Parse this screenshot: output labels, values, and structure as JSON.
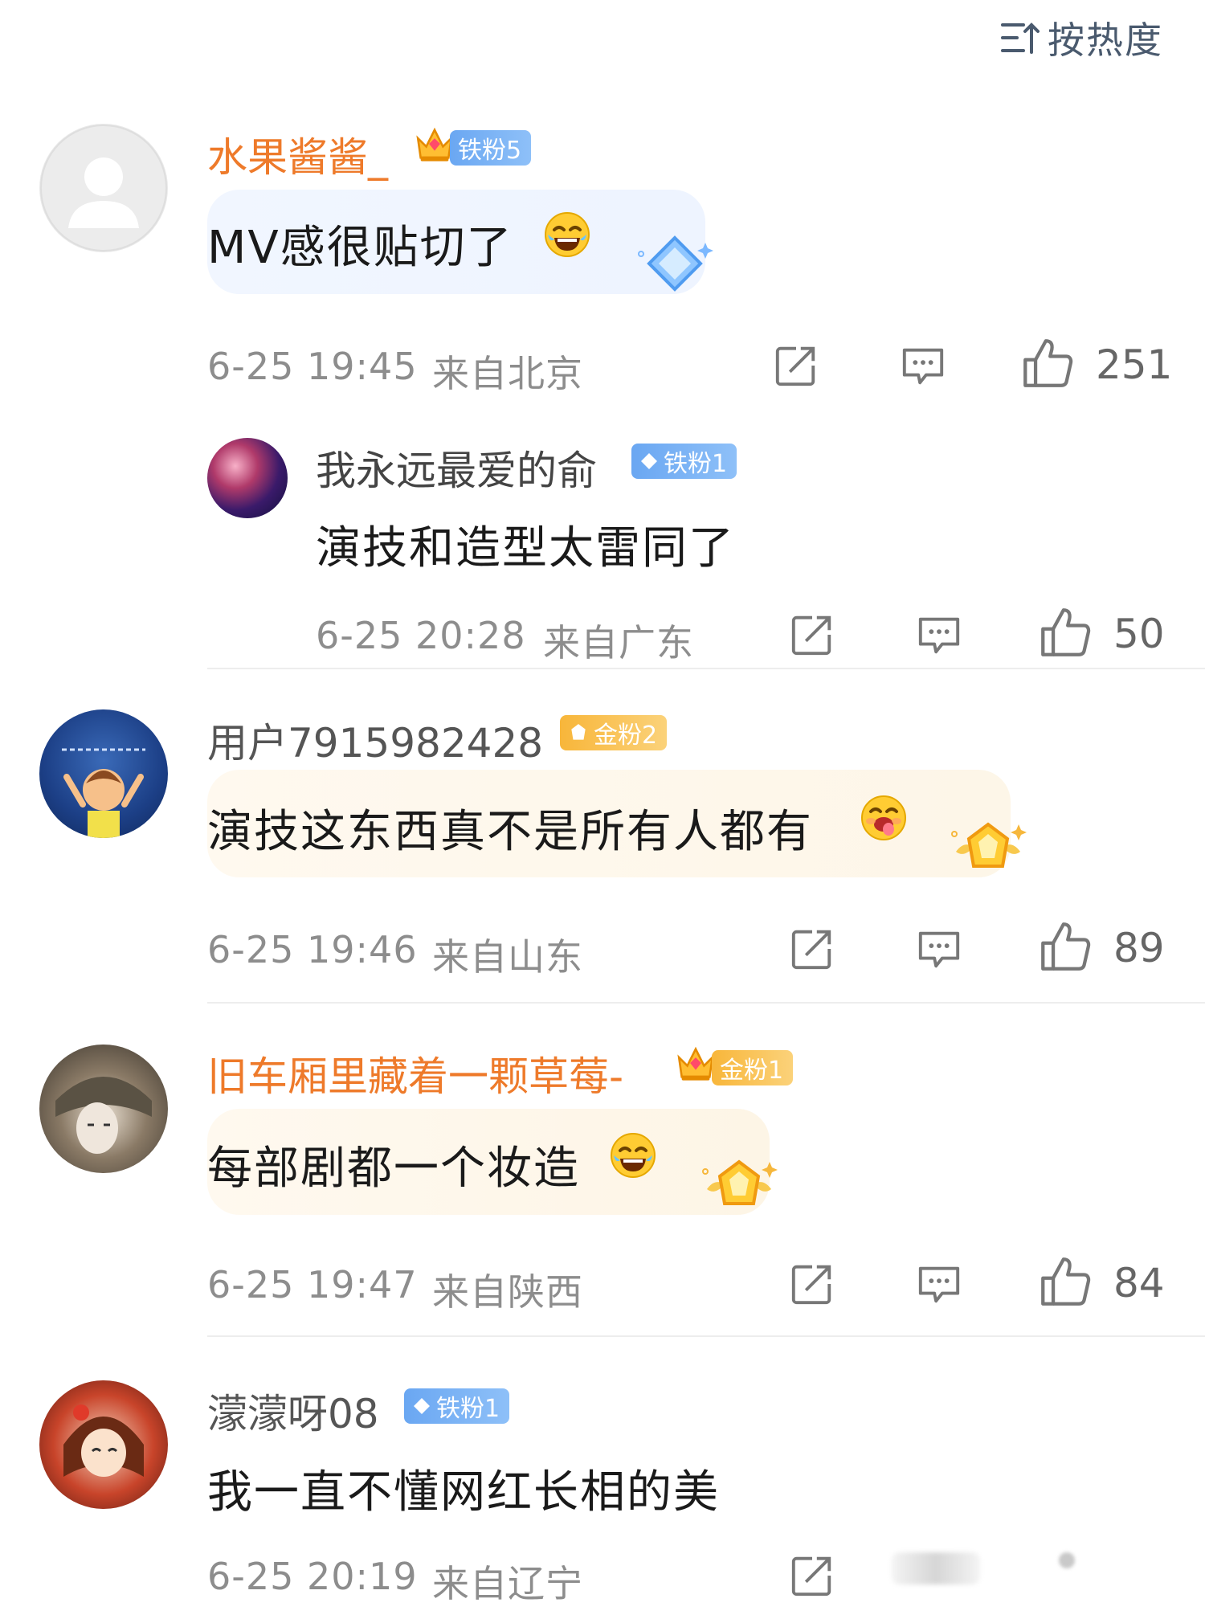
{
  "sort": {
    "label": "按热度",
    "icon": "sort-icon"
  },
  "colors": {
    "username_highlight": "#ee7a2a",
    "username_normal": "#555555",
    "meta": "#8d8d8d",
    "badge_iron": "#6aa7f2",
    "badge_gold": "#f8b63a"
  },
  "comments": [
    {
      "username": "水果酱酱_",
      "badge": "铁粉5",
      "text": "MV感很贴切了",
      "emoji": "laugh-cry-emoji",
      "time": "6-25 19:45",
      "location": "来自北京",
      "likes": "251",
      "reply": {
        "username": "我永远最爱的俞",
        "badge": "铁粉1",
        "text": "演技和造型太雷同了",
        "time": "6-25 20:28",
        "location": "来自广东",
        "likes": "50"
      }
    },
    {
      "username": "用户7915982428",
      "badge": "金粉2",
      "text": "演技这东西真不是所有人都有",
      "emoji": "drool-emoji",
      "time": "6-25 19:46",
      "location": "来自山东",
      "likes": "89"
    },
    {
      "username": "旧车厢里藏着一颗草莓-",
      "badge": "金粉1",
      "text": "每部剧都一个妆造",
      "emoji": "laugh-cry-emoji",
      "time": "6-25 19:47",
      "location": "来自陕西",
      "likes": "84"
    },
    {
      "username": "濛濛呀08",
      "badge": "铁粉1",
      "text": "我一直不懂网红长相的美",
      "time": "6-25 20:19",
      "location": "来自辽宁"
    }
  ]
}
